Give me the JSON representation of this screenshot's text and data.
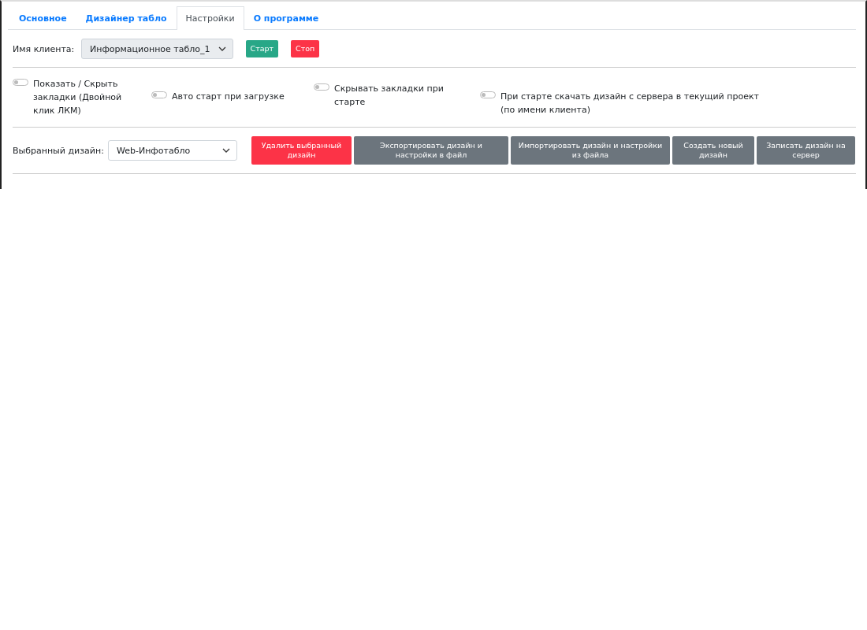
{
  "tabs": [
    {
      "label": "Основное",
      "selected": false
    },
    {
      "label": "Дизайнер табло",
      "selected": false
    },
    {
      "label": "Настройки",
      "selected": true
    },
    {
      "label": "О программе",
      "selected": false
    }
  ],
  "client": {
    "label": "Имя клиента:",
    "value": "Информационное табло_1",
    "buttons": [
      {
        "label": "Старт",
        "kind": "success"
      },
      {
        "label": "Стоп",
        "kind": "danger"
      }
    ]
  },
  "toggles": [
    {
      "label": "Показать / Скрыть закладки (Двойной клик ЛКМ)",
      "on": false
    },
    {
      "label": "Авто старт при загрузке",
      "on": false
    },
    {
      "label": "Скрывать закладки при старте",
      "on": false
    },
    {
      "label": "При старте скачать дизайн с сервера в текущий проект (по имени клиента)",
      "on": false
    }
  ],
  "design": {
    "label": "Выбранный дизайн:",
    "value": "Web-Инфотабло",
    "buttons": [
      {
        "label": "Удалить выбранный дизайн",
        "kind": "danger"
      },
      {
        "label": "Экспортировать дизайн и настройки в файл",
        "kind": "secondary"
      },
      {
        "label": "Импортировать дизайн и настройки из файла",
        "kind": "secondary"
      },
      {
        "label": "Создать новый дизайн",
        "kind": "secondary"
      },
      {
        "label": "Записать дизайн на сервер",
        "kind": "secondary"
      }
    ]
  }
}
